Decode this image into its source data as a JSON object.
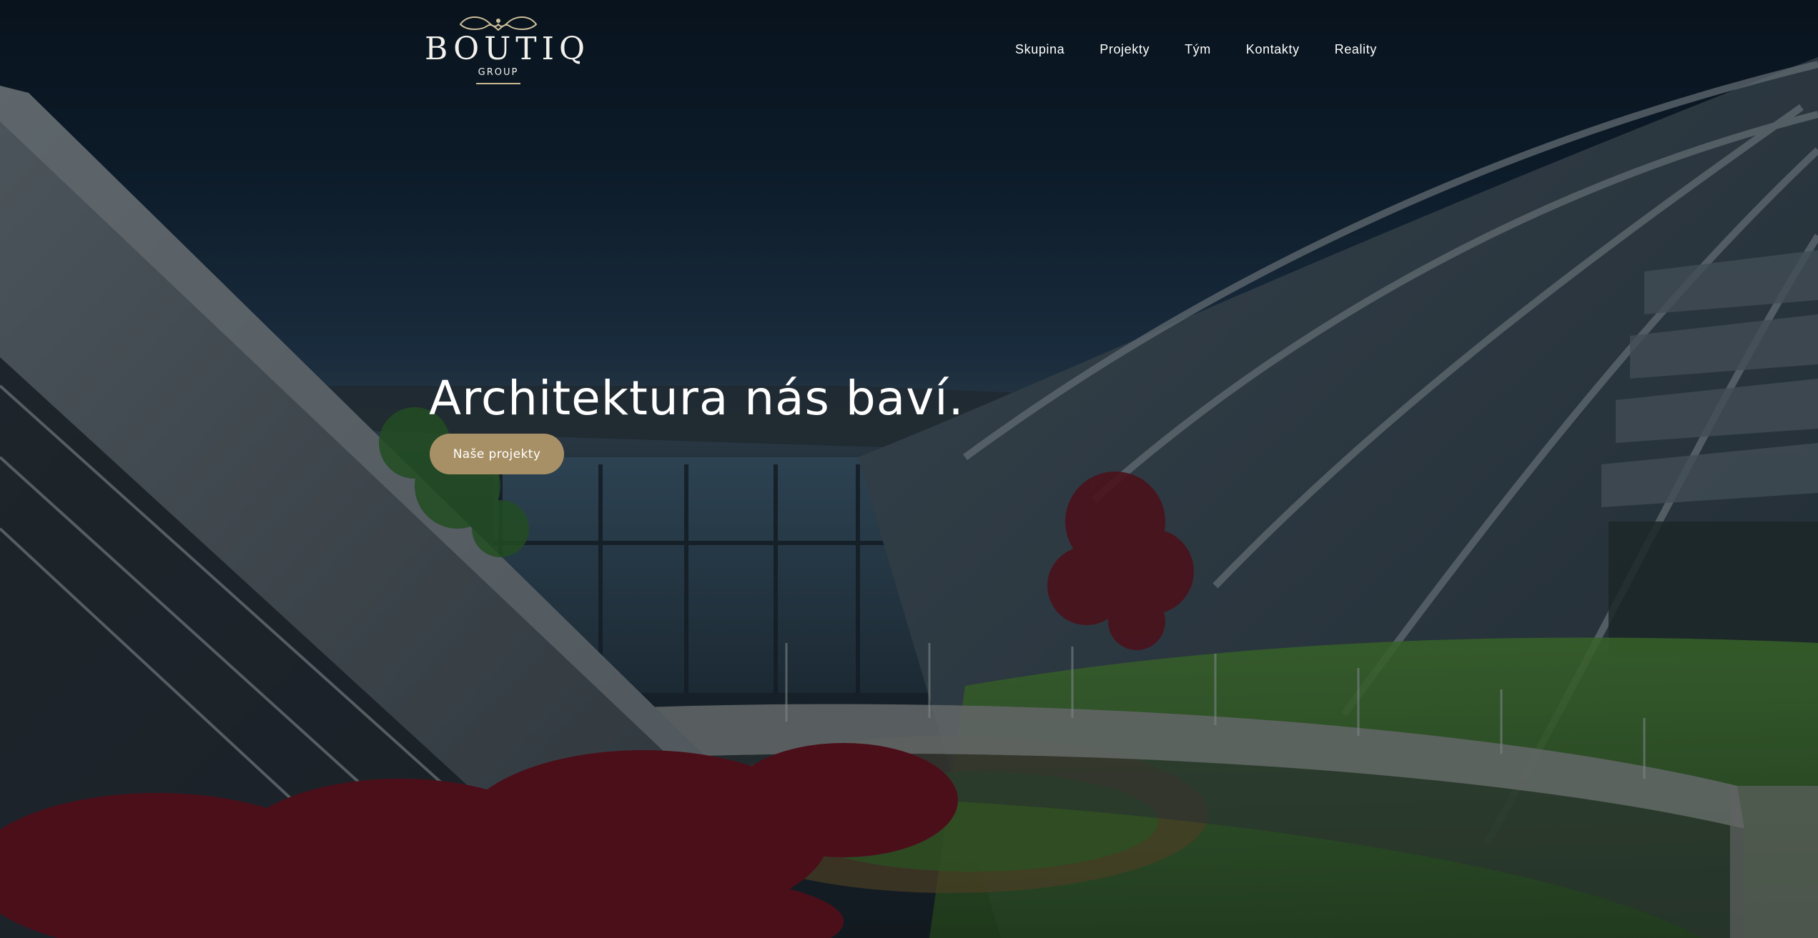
{
  "brand": {
    "wordmark": "BOUTIQ",
    "submark": "GROUP"
  },
  "nav": {
    "items": [
      {
        "label": "Skupina"
      },
      {
        "label": "Projekty"
      },
      {
        "label": "Tým"
      },
      {
        "label": "Kontakty"
      },
      {
        "label": "Reality"
      }
    ]
  },
  "hero": {
    "headline": "Architektura nás baví.",
    "cta_label": "Naše projekty"
  },
  "colors": {
    "accent": "#a89066",
    "text": "#ffffff",
    "overlay": "#0b1622"
  }
}
